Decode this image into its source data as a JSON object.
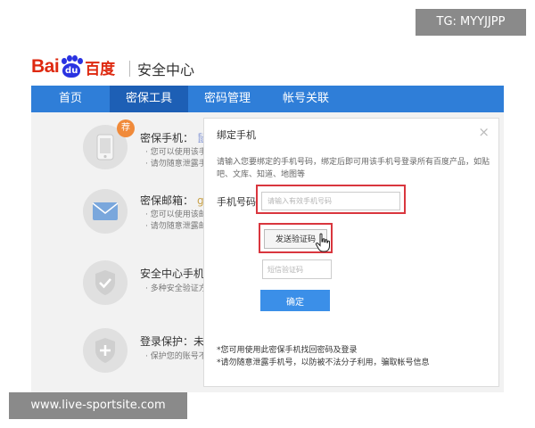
{
  "watermarks": {
    "top": "TG: MYYJJPP",
    "bottom": "www.live-sportsite.com"
  },
  "header": {
    "logo_latin_left": "Bai",
    "logo_latin_paw": "du",
    "logo_cn": "百度",
    "site_name": "安全中心"
  },
  "nav": {
    "items": [
      {
        "label": "首页"
      },
      {
        "label": "密保工具"
      },
      {
        "label": "密码管理"
      },
      {
        "label": "帐号关联"
      }
    ],
    "active_index": 1
  },
  "list": {
    "items": [
      {
        "icon": "phone-icon",
        "badge": "荐",
        "title": "密保手机：",
        "value": "鼠",
        "desc": [
          "· 您可以使用该手",
          "· 请勿随意泄露手"
        ]
      },
      {
        "icon": "mail-icon",
        "title": "密保邮箱：",
        "value": "gu.",
        "desc": [
          "· 您可以使用该邮",
          "· 请勿随意泄露邮"
        ]
      },
      {
        "icon": "shield-check-icon",
        "title": "安全中心手机版",
        "value": "",
        "desc": [
          "· 多种安全验证方"
        ]
      },
      {
        "icon": "shield-plus-icon",
        "title": "登录保护：未开",
        "value": "",
        "desc": [
          "· 保护您的账号不"
        ]
      }
    ]
  },
  "modal": {
    "title": "绑定手机",
    "close": "×",
    "intro": "请输入您要绑定的手机号码，绑定后即可用该手机号登录所有百度产品，如贴吧、文库、知道、地图等",
    "phone_label": "手机号码",
    "phone_placeholder": "请输入有效手机号码",
    "send_button": "发送验证码",
    "code_placeholder": "短信验证码",
    "confirm_button": "确定",
    "notes": [
      "*您可用使用此密保手机找回密码及登录",
      "*请勿随意泄露手机号，以防被不法分子利用，骗取帐号信息"
    ]
  },
  "colors": {
    "brand_red": "#de2910",
    "brand_blue": "#2932e1",
    "nav_bg": "#2f7ed8",
    "nav_active": "#1d5fb5",
    "highlight": "#d9363e",
    "confirm": "#3b8fe8",
    "badge": "#f08a3a"
  }
}
